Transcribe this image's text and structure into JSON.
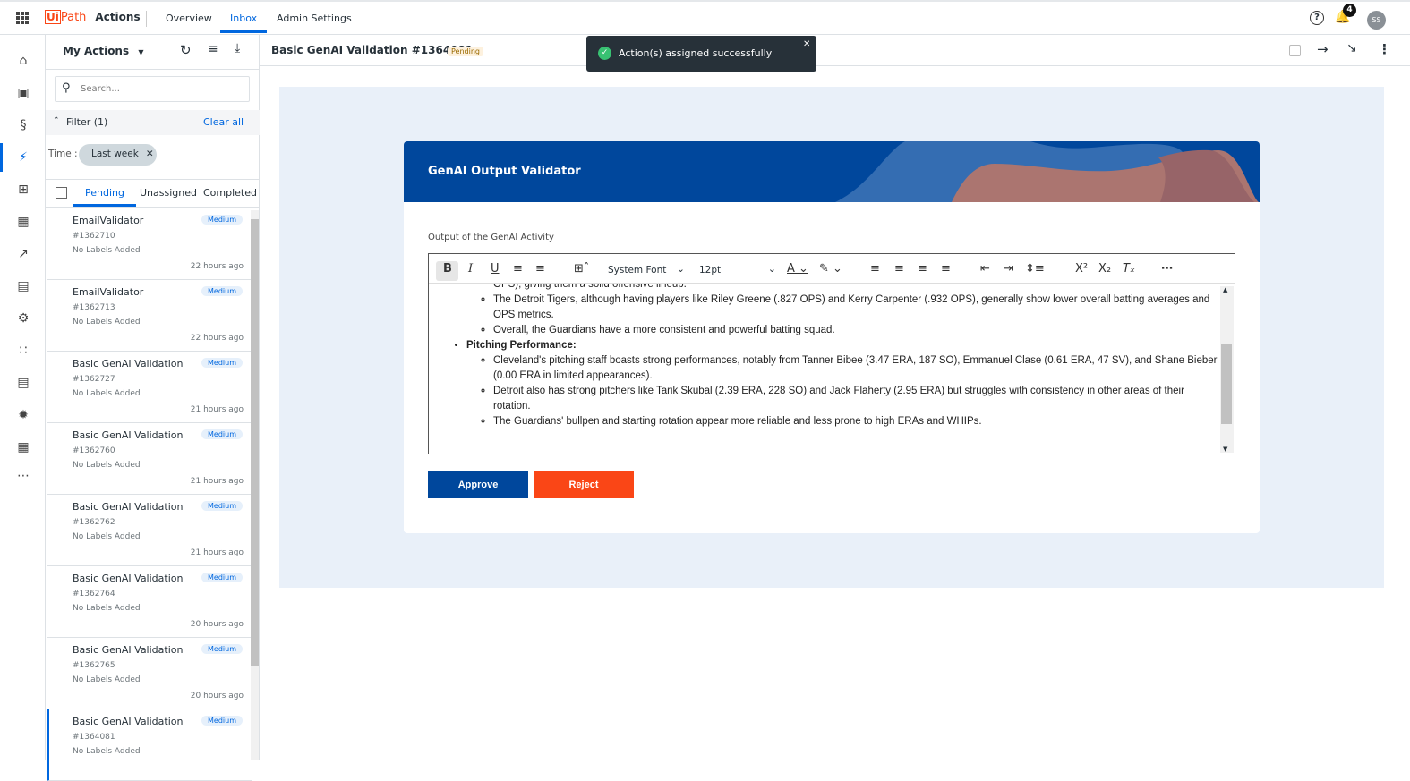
{
  "app": {
    "logo_ui": "Ui",
    "logo_path": "Path",
    "name": "Actions"
  },
  "nav": [
    {
      "label": "Overview"
    },
    {
      "label": "Inbox",
      "active": true
    },
    {
      "label": "Admin Settings"
    }
  ],
  "header_right": {
    "help_icon": "question-circle",
    "notifications_count": "4",
    "avatar_initials": "SS"
  },
  "list_panel": {
    "title": "My Actions",
    "search_placeholder": "Search...",
    "filter_label": "Filter (1)",
    "clear_all": "Clear all",
    "time_label": "Time :",
    "time_chip": "Last week",
    "tabs": [
      "Pending",
      "Unassigned",
      "Completed"
    ],
    "active_tab": "Pending",
    "items": [
      {
        "title": "EmailValidator",
        "id": "#1362710",
        "labels": "No Labels Added",
        "priority": "Medium",
        "time": "22 hours ago"
      },
      {
        "title": "EmailValidator",
        "id": "#1362713",
        "labels": "No Labels Added",
        "priority": "Medium",
        "time": "22 hours ago"
      },
      {
        "title": "Basic GenAI Validation",
        "id": "#1362727",
        "labels": "No Labels Added",
        "priority": "Medium",
        "time": "21 hours ago"
      },
      {
        "title": "Basic GenAI Validation",
        "id": "#1362760",
        "labels": "No Labels Added",
        "priority": "Medium",
        "time": "21 hours ago"
      },
      {
        "title": "Basic GenAI Validation",
        "id": "#1362762",
        "labels": "No Labels Added",
        "priority": "Medium",
        "time": "21 hours ago"
      },
      {
        "title": "Basic GenAI Validation",
        "id": "#1362764",
        "labels": "No Labels Added",
        "priority": "Medium",
        "time": "20 hours ago"
      },
      {
        "title": "Basic GenAI Validation",
        "id": "#1362765",
        "labels": "No Labels Added",
        "priority": "Medium",
        "time": "20 hours ago"
      },
      {
        "title": "Basic GenAI Validation",
        "id": "#1364081",
        "labels": "No Labels Added",
        "priority": "Medium",
        "time": "",
        "selected": true
      }
    ]
  },
  "detail": {
    "title": "Basic GenAI Validation #1364081",
    "status": "Pending"
  },
  "toast": {
    "message": "Action(s) assigned successfully"
  },
  "form": {
    "header": "GenAI Output Validator",
    "field_label": "Output of the GenAI Activity",
    "font": "System Font",
    "size": "12pt",
    "approve": "Approve",
    "reject": "Reject",
    "content": {
      "l1": "OPS), giving them a solid offensive lineup.",
      "l2": "The Detroit Tigers, although having players like Riley Greene (.827 OPS) and Kerry Carpenter (.932 OPS), generally show lower overall batting averages and OPS metrics.",
      "l3": "Overall, the Guardians have a more consistent and powerful batting squad.",
      "h2": "Pitching Performance:",
      "p1": "Cleveland's pitching staff boasts strong performances, notably from Tanner Bibee (3.47 ERA, 187 SO), Emmanuel Clase (0.61 ERA, 47 SV), and Shane Bieber (0.00 ERA in limited appearances).",
      "p2": "Detroit also has strong pitchers like Tarik Skubal (2.39 ERA, 228 SO) and Jack Flaherty (2.95 ERA) but struggles with consistency in other areas of their rotation.",
      "p3": "The Guardians' bullpen and starting rotation appear more reliable and less prone to high ERAs and WHIPs."
    }
  },
  "colors": {
    "accent": "#0067df",
    "header_band": "#00479c",
    "approve": "#00479c",
    "reject": "#fa4616",
    "badge_pending": "#fdf1de"
  }
}
